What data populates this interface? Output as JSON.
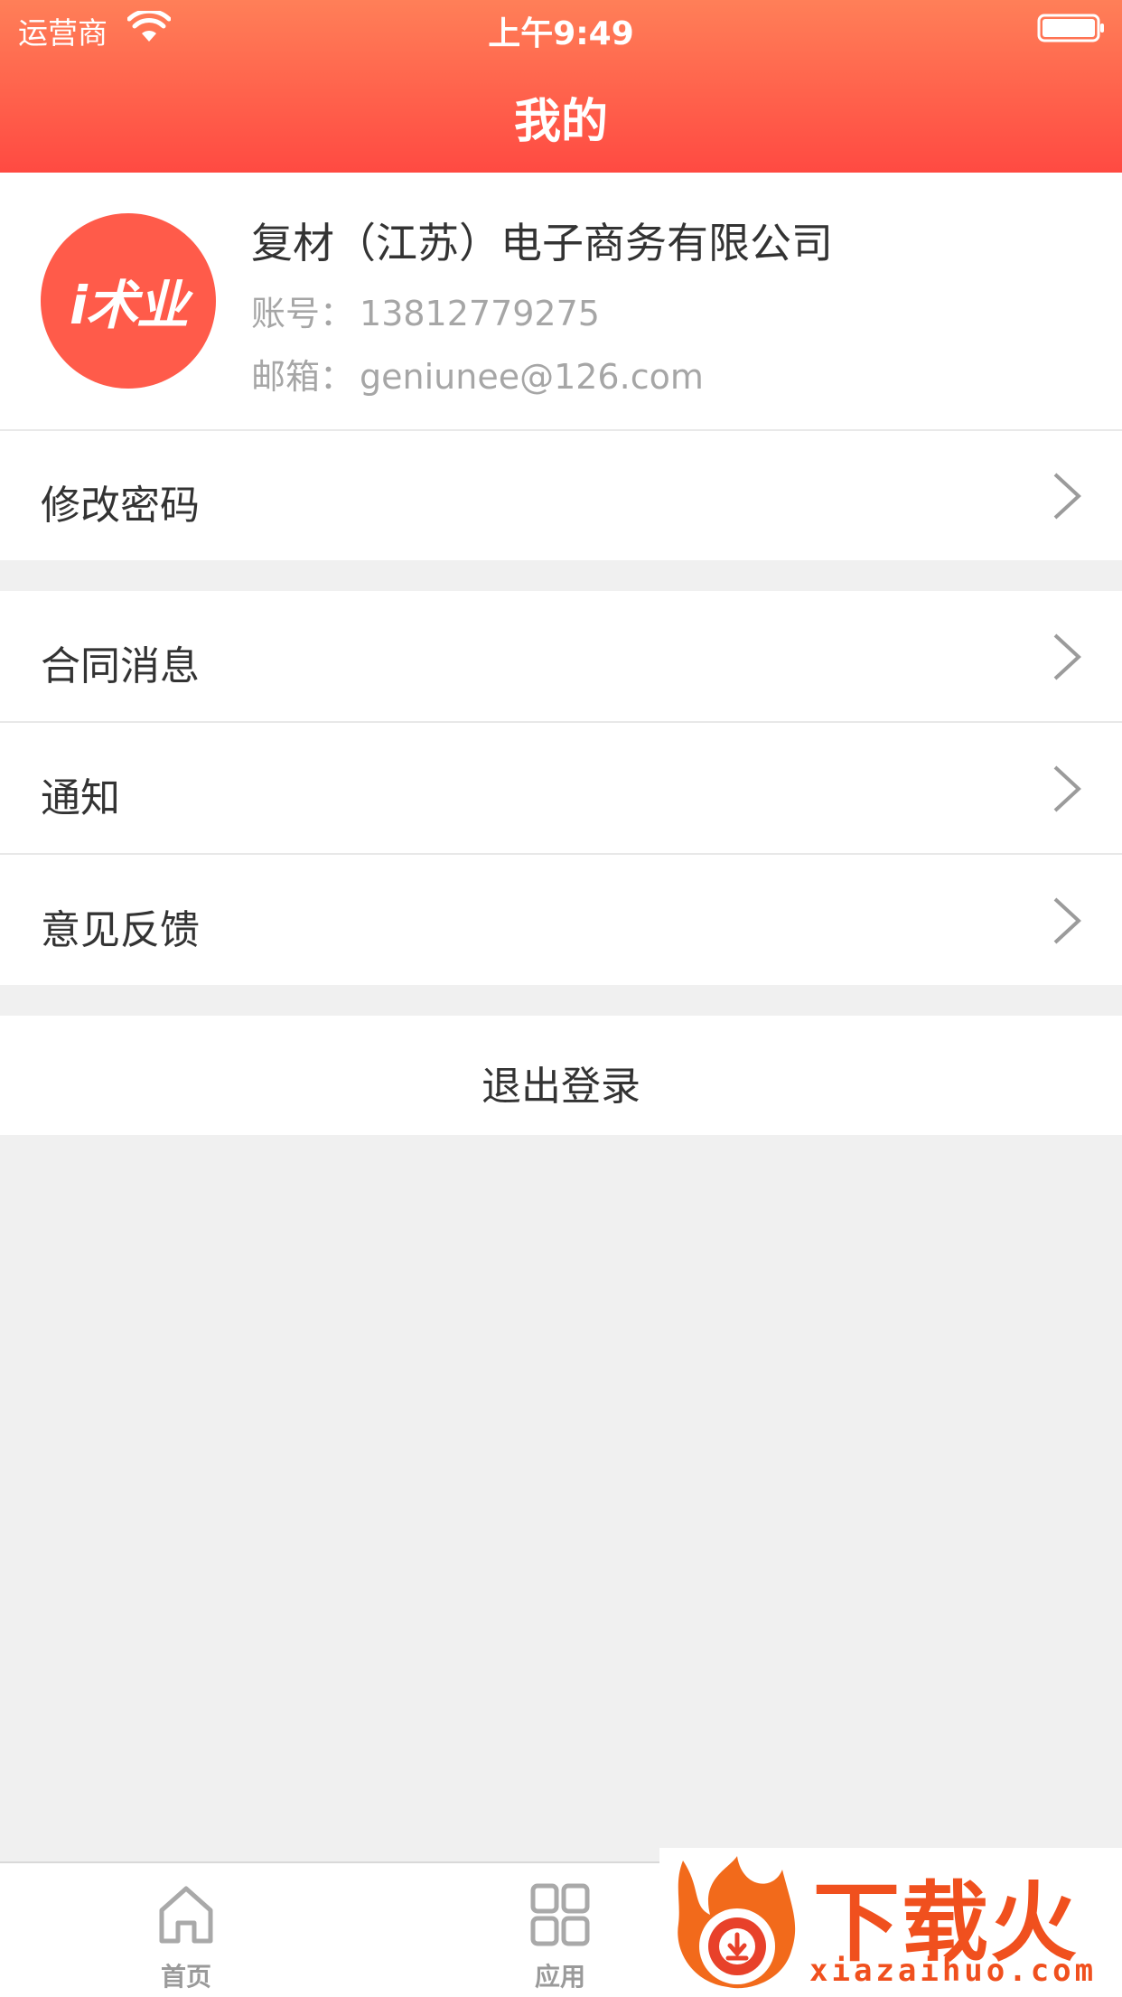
{
  "status_bar": {
    "carrier": "运营商",
    "time": "上午9:49"
  },
  "header": {
    "title": "我的"
  },
  "profile": {
    "avatar_text": "i术业",
    "company": "复材（江苏）电子商务有限公司",
    "account_label": "账号：",
    "account_value": "13812779275",
    "email_label": "邮箱：",
    "email_value": "geniunee@126.com"
  },
  "menu": {
    "change_password": "修改密码",
    "contract_messages": "合同消息",
    "notifications": "通知",
    "feedback": "意见反馈",
    "logout": "退出登录"
  },
  "tabbar": {
    "home_label": "首页",
    "apps_label": "应用"
  },
  "watermark": {
    "text": "下载火",
    "url": "xiazaihuo.com"
  },
  "colors": {
    "header_top": "#ff7f58",
    "header_bottom": "#ff4a42",
    "avatar_bg": "#ff5b4a",
    "background": "#f0f0f0"
  }
}
